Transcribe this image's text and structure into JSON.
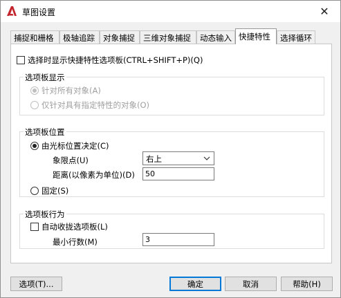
{
  "window": {
    "title": "草图设置",
    "close_glyph": "✕"
  },
  "tabs": [
    {
      "label": "捕捉和栅格"
    },
    {
      "label": "极轴追踪"
    },
    {
      "label": "对象捕捉"
    },
    {
      "label": "三维对象捕捉"
    },
    {
      "label": "动态输入"
    },
    {
      "label": "快捷特性"
    },
    {
      "label": "选择循环"
    }
  ],
  "active_tab": "快捷特性",
  "show_palette": {
    "label": "选择时显示快捷特性选项板(CTRL+SHIFT+P)(Q)",
    "checked": false
  },
  "palette_display": {
    "title": "选项板显示",
    "options": [
      {
        "label": "针对所有对象(A)",
        "selected": true,
        "enabled": false
      },
      {
        "label": "仅针对具有指定特性的对象(O)",
        "selected": false,
        "enabled": false
      }
    ]
  },
  "palette_location": {
    "title": "选项板位置",
    "cursor_option": {
      "label": "由光标位置决定(C)",
      "selected": true
    },
    "quadrant_label": "象限点(U)",
    "quadrant_value": "右上",
    "distance_label": "距离(以像素为单位)(D)",
    "distance_value": "50",
    "static_option": {
      "label": "固定(S)",
      "selected": false
    }
  },
  "palette_behavior": {
    "title": "选项板行为",
    "auto_collapse": {
      "label": "自动收拢选项板(L)",
      "checked": false
    },
    "min_rows_label": "最小行数(M)",
    "min_rows_value": "3"
  },
  "buttons": {
    "options": "选项(T)...",
    "ok": "确定",
    "cancel": "取消",
    "help": "帮助(H)"
  },
  "colors": {
    "app_icon_red": "#c4262e",
    "default_button_border": "#0078d7"
  }
}
